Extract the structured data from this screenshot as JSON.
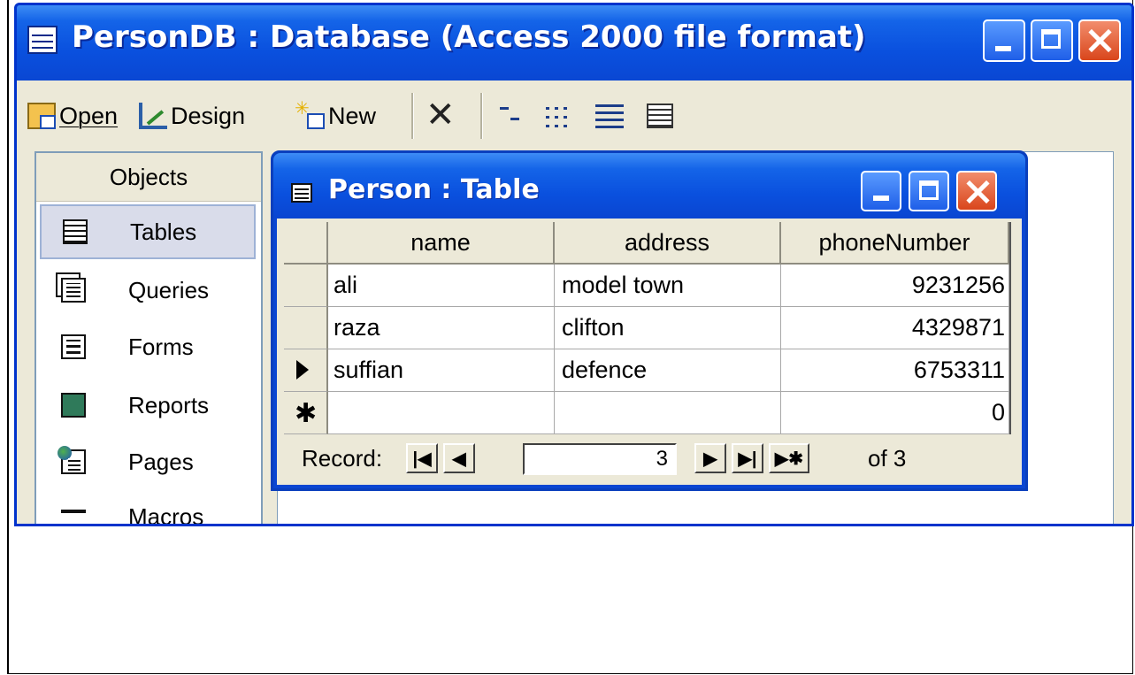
{
  "db_window": {
    "title": "PersonDB : Database (Access 2000 file format)"
  },
  "toolbar": {
    "open_label": "Open",
    "design_label": "Design",
    "new_label": "New",
    "delete_glyph": "✕"
  },
  "objects_bar": {
    "header": "Objects",
    "items": [
      {
        "label": "Tables",
        "icon": "table-icon",
        "active": true
      },
      {
        "label": "Queries",
        "icon": "query-icon"
      },
      {
        "label": "Forms",
        "icon": "form-icon"
      },
      {
        "label": "Reports",
        "icon": "report-icon"
      },
      {
        "label": "Pages",
        "icon": "page-icon"
      },
      {
        "label": "Macros",
        "icon": "macro-icon"
      }
    ]
  },
  "table_window": {
    "title": "Person : Table",
    "columns": [
      "name",
      "address",
      "phoneNumber"
    ],
    "rows": [
      {
        "name": "ali",
        "address": "model town",
        "phoneNumber": "9231256"
      },
      {
        "name": "raza",
        "address": "clifton",
        "phoneNumber": "4329871"
      },
      {
        "name": "suffian",
        "address": "defence",
        "phoneNumber": "6753311"
      },
      {
        "name": "",
        "address": "",
        "phoneNumber": "0"
      }
    ],
    "new_row_glyph": "✱",
    "navigation": {
      "label": "Record:",
      "current": "3",
      "of_text": "of 3"
    }
  }
}
